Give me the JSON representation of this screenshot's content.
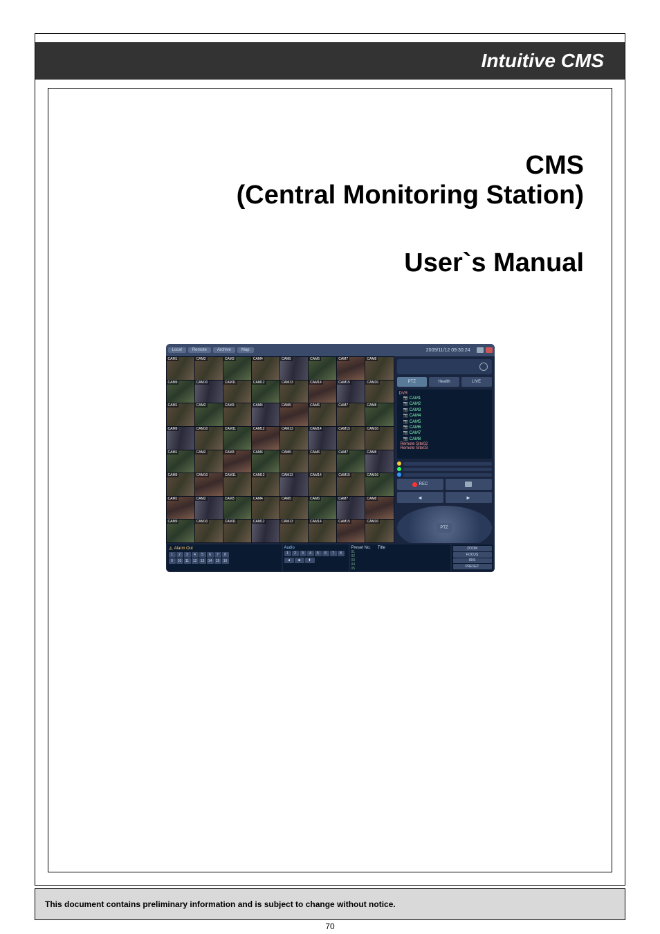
{
  "header": {
    "product_name": "Intuitive CMS"
  },
  "titles": {
    "main_line1": "CMS",
    "main_line2": "(Central Monitoring Station)",
    "subtitle": "User`s Manual"
  },
  "screenshot": {
    "tabs": [
      "Local",
      "Remote",
      "Archive",
      "Map"
    ],
    "timestamp": "2009/11/12 09:30:24",
    "right_panel": {
      "mode_buttons": [
        "PTZ",
        "Health",
        "LIVE"
      ],
      "tree_root": "DVR",
      "tree_items": [
        "CAM1",
        "CAM2",
        "CAM3",
        "CAM4",
        "CAM5",
        "CAM6",
        "CAM7",
        "CAM8"
      ],
      "tree_remote": [
        "Remote Site02",
        "Remote Site03"
      ],
      "dpad_center": "PTZ",
      "rec_label": "REC"
    },
    "bottom": {
      "alarm_title": "Alarm Out",
      "alarm_numbers_row1": [
        "1",
        "2",
        "3",
        "4",
        "5",
        "6",
        "7",
        "8"
      ],
      "alarm_numbers_row2": [
        "9",
        "10",
        "11",
        "12",
        "13",
        "14",
        "15",
        "16"
      ],
      "audio_title": "Audio",
      "audio_numbers": [
        "1",
        "2",
        "3",
        "4",
        "5",
        "6",
        "7",
        "8"
      ],
      "preset_header_no": "Preset No.",
      "preset_header_title": "Title",
      "preset_rows": [
        "01",
        "02",
        "03",
        "04",
        "05"
      ],
      "corner_buttons": [
        "ZOOM",
        "FOCUS",
        "IRIS",
        "PRESET"
      ]
    },
    "camera_label_prefix": "CAM"
  },
  "footer": {
    "disclaimer": "This document contains preliminary information and is subject to change without notice."
  },
  "page_number": "70"
}
